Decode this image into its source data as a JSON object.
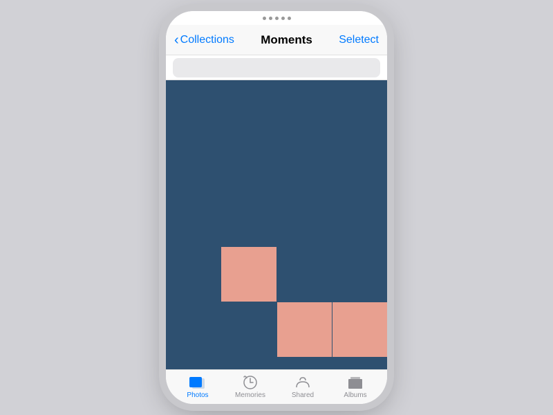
{
  "statusBar": {
    "dots": 5
  },
  "navBar": {
    "backLabel": "Collections",
    "title": "Moments",
    "actionLabel": "Seletect"
  },
  "grid": {
    "columns": 4,
    "rows": 6,
    "cells": [
      {
        "row": 0,
        "col": 0,
        "type": "blue"
      },
      {
        "row": 0,
        "col": 1,
        "type": "blue"
      },
      {
        "row": 0,
        "col": 2,
        "type": "blue"
      },
      {
        "row": 0,
        "col": 3,
        "type": "blue"
      },
      {
        "row": 1,
        "col": 0,
        "type": "blue"
      },
      {
        "row": 1,
        "col": 1,
        "type": "blue"
      },
      {
        "row": 1,
        "col": 2,
        "type": "blue"
      },
      {
        "row": 1,
        "col": 3,
        "type": "blue"
      },
      {
        "row": 2,
        "col": 0,
        "type": "blue"
      },
      {
        "row": 2,
        "col": 1,
        "type": "blue"
      },
      {
        "row": 2,
        "col": 2,
        "type": "blue"
      },
      {
        "row": 2,
        "col": 3,
        "type": "blue"
      },
      {
        "row": 3,
        "col": 0,
        "type": "blue"
      },
      {
        "row": 3,
        "col": 1,
        "type": "salmon"
      },
      {
        "row": 3,
        "col": 2,
        "type": "blue"
      },
      {
        "row": 3,
        "col": 3,
        "type": "blue"
      },
      {
        "row": 4,
        "col": 0,
        "type": "blue"
      },
      {
        "row": 4,
        "col": 1,
        "type": "blue"
      },
      {
        "row": 4,
        "col": 2,
        "type": "salmon"
      },
      {
        "row": 4,
        "col": 3,
        "type": "salmon"
      },
      {
        "row": 5,
        "col": 0,
        "type": "blue"
      },
      {
        "row": 5,
        "col": 1,
        "type": "blue"
      },
      {
        "row": 5,
        "col": 2,
        "type": "blue"
      },
      {
        "row": 5,
        "col": 3,
        "type": "blue"
      }
    ]
  },
  "tabBar": {
    "items": [
      {
        "id": "photos",
        "label": "Photos",
        "active": true
      },
      {
        "id": "memories",
        "label": "Memories",
        "active": false
      },
      {
        "id": "shared",
        "label": "Shared",
        "active": false
      },
      {
        "id": "albums",
        "label": "Albums",
        "active": false
      }
    ]
  }
}
